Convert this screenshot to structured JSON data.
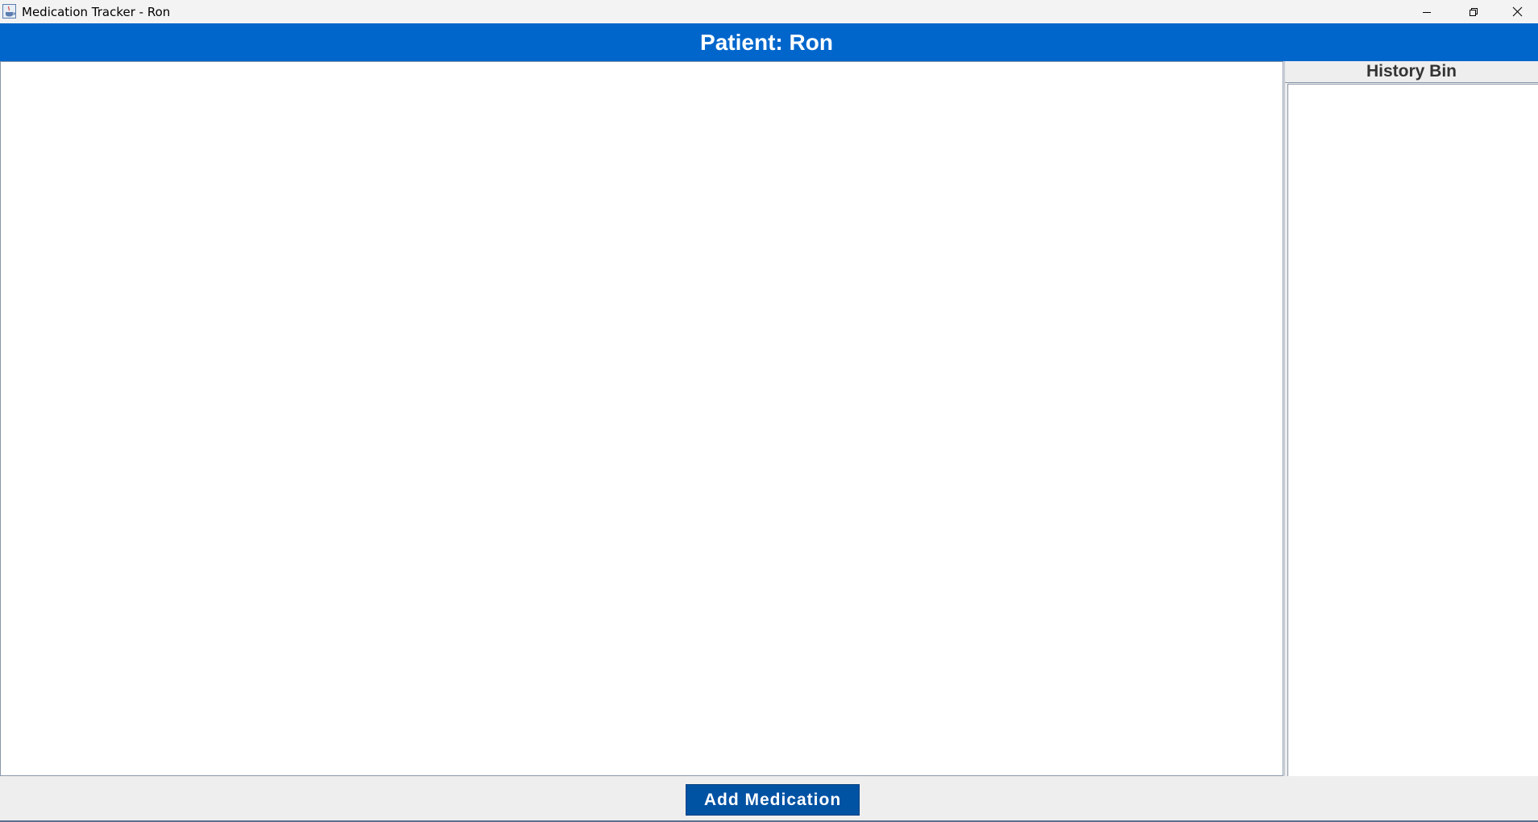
{
  "window": {
    "title": "Medication Tracker - Ron",
    "controls": {
      "minimize_icon": "minimize-icon",
      "restore_icon": "restore-icon",
      "close_icon": "close-icon"
    }
  },
  "header": {
    "title": "Patient: Ron",
    "background_color": "#0066cc"
  },
  "main": {
    "medications": []
  },
  "history_bin": {
    "title": "History Bin",
    "items": []
  },
  "footer": {
    "add_button_label": "Add Medication",
    "add_button_color": "#0052a3"
  }
}
